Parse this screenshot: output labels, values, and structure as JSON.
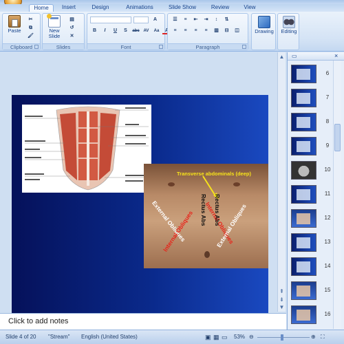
{
  "ribbon": {
    "tabs": [
      "Home",
      "Insert",
      "Design",
      "Animations",
      "Slide Show",
      "Review",
      "View"
    ],
    "active_tab": "Home",
    "groups": {
      "clipboard": {
        "label": "Clipboard",
        "paste": "Paste"
      },
      "slides": {
        "label": "Slides",
        "new_slide_line1": "New",
        "new_slide_line2": "Slide"
      },
      "font": {
        "label": "Font",
        "buttons": [
          "B",
          "I",
          "U",
          "S",
          "abc",
          "AV",
          "Aa",
          "A"
        ]
      },
      "paragraph": {
        "label": "Paragraph"
      },
      "drawing": {
        "label": "Drawing"
      },
      "editing": {
        "label": "Editing"
      }
    }
  },
  "slide": {
    "photo_labels": {
      "transverse": "Transverse abdominals (deep)",
      "internal_obliques_right": "Internal Obliques",
      "external_obliques_right": "External Obliques",
      "rectus_abs_left": "Rectus Abs",
      "rectus_abs_right": "Rectus Abs",
      "external_obliques_left": "External Obliques",
      "internal_obliques_left": "Internal Obliques"
    }
  },
  "thumbnails": [
    {
      "num": "6",
      "kind": "diagram"
    },
    {
      "num": "7",
      "kind": "diagram"
    },
    {
      "num": "8",
      "kind": "blue"
    },
    {
      "num": "9",
      "kind": "blue"
    },
    {
      "num": "10",
      "kind": "scan"
    },
    {
      "num": "11",
      "kind": "blue"
    },
    {
      "num": "12",
      "kind": "photo"
    },
    {
      "num": "13",
      "kind": "blue"
    },
    {
      "num": "14",
      "kind": "blue"
    },
    {
      "num": "15",
      "kind": "photo"
    },
    {
      "num": "16",
      "kind": "photo"
    }
  ],
  "notes": {
    "placeholder": "Click to add notes"
  },
  "status": {
    "slide": "Slide 4 of 20",
    "theme": "\"Stream\"",
    "language": "English (United States)",
    "zoom": "53%"
  },
  "colors": {
    "ribbon": "#d4e3f5",
    "slide_bg": "#0a2a8c",
    "accent": "#f0b93d"
  }
}
